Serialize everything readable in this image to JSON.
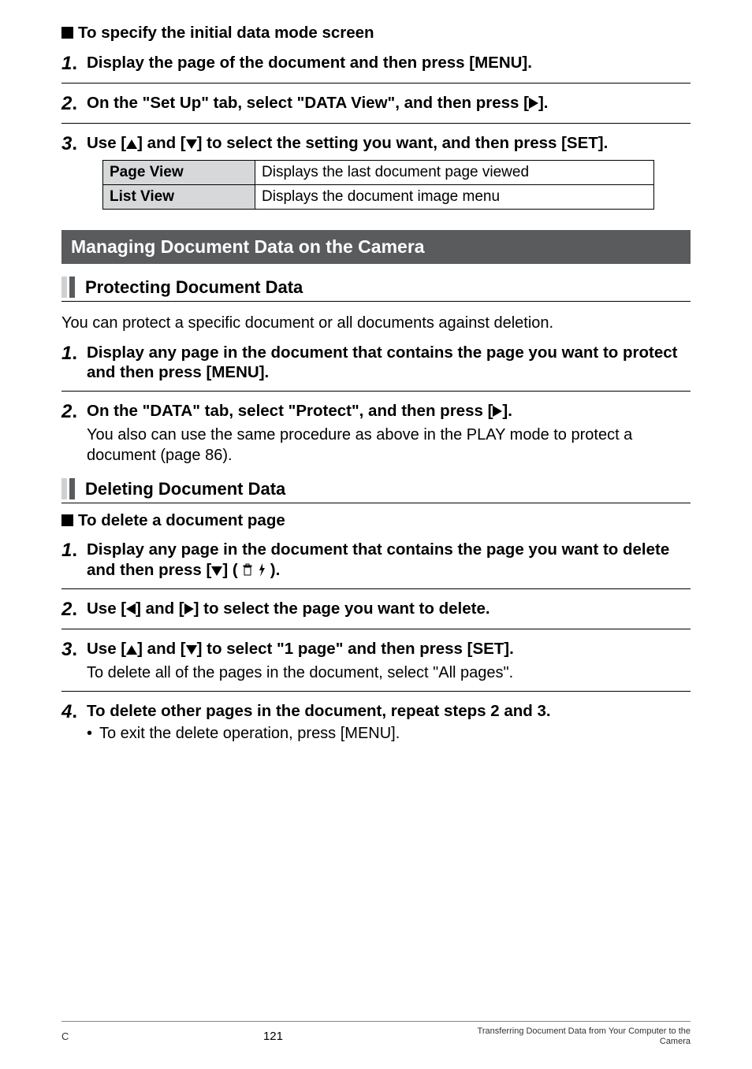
{
  "sec1": {
    "title": "To specify the initial data mode screen",
    "step1": "Display the page of the document and then press [MENU].",
    "step2a": "On the \"Set Up\" tab, select \"DATA View\", and then press [",
    "step2b": "].",
    "step3a": "Use [",
    "step3b": "] and [",
    "step3c": "] to select the setting you want, and then press [SET]."
  },
  "table": {
    "r1c1": "Page View",
    "r1c2": "Displays the last document page viewed",
    "r2c1": "List View",
    "r2c2": "Displays the document image menu"
  },
  "band": "Managing Document Data on the Camera",
  "sub1": "Protecting Document Data",
  "para1": "You can protect a specific document or all documents against deletion.",
  "protect": {
    "step1": "Display any page in the document that contains the page you want to protect and then press [MENU].",
    "step2a": "On the \"DATA\" tab, select \"Protect\", and then press [",
    "step2b": "].",
    "step2body": "You also can use the same procedure as above in the PLAY mode to protect a document (page 86)."
  },
  "sub2": "Deleting Document Data",
  "sec2": "To delete a document page",
  "delete": {
    "step1a": "Display any page in the document that contains the page you want to delete and then press [",
    "step1b": "] ( ",
    "step1c": " ).",
    "step2a": "Use [",
    "step2b": "] and [",
    "step2c": "] to select the page you want to delete.",
    "step3a": "Use [",
    "step3b": "] and [",
    "step3c": "] to select \"1 page\" and then press [SET].",
    "step3body": "To delete all of the pages in the document, select \"All pages\".",
    "step4": "To delete other pages in the document, repeat steps 2 and 3.",
    "step4bullet": "To exit the delete operation, press [MENU]."
  },
  "footer": {
    "c": "C",
    "page": "121",
    "chapterA": "Transferring Document Data from Your Computer to the",
    "chapterB": "Camera"
  }
}
